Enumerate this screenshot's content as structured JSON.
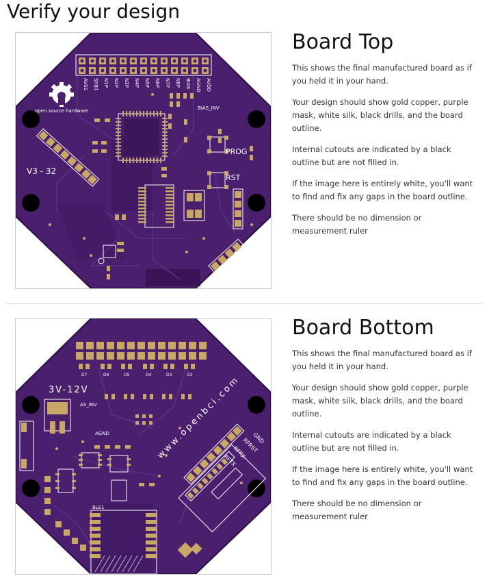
{
  "page": {
    "title": "Verify your design"
  },
  "sections": [
    {
      "heading": "Board Top",
      "paragraphs": [
        "This shows the final manufactured board as if you held it in your hand.",
        "Your design should show gold copper, purple mask, white silk, black drills, and the board outline.",
        "Internal cutouts are indicated by a black outline but are not filled in.",
        "If the image here is entirely white, you'll want to find and fix any gaps in the board outline.",
        "There should be no dimension or measurement ruler"
      ],
      "silk": {
        "version": "V3 - 32",
        "logo": "open source hardware",
        "prog": "PROG",
        "rst": "RST",
        "bias_inv": "BIAS_INV",
        "header_labels": [
          "AVSS",
          "SRB1",
          "N1P",
          "N2P",
          "N3P",
          "N4P",
          "N5P",
          "N6P",
          "N7P",
          "N8P",
          "BIAS",
          "AGND",
          "AVDD"
        ]
      }
    },
    {
      "heading": "Board Bottom",
      "paragraphs": [
        "This shows the final manufactured board as if you held it in your hand.",
        "Your design should show gold copper, purple mask, white silk, black drills, and the board outline.",
        "Internal cutouts are indicated by a black outline but are not filled in.",
        "If the image here is entirely white, you'll want to find and fix any gaps in the board outline.",
        "There should be no dimension or measurement ruler"
      ],
      "silk": {
        "voltage": "3V-12V",
        "url": "www.openbci.com",
        "ble": "BLE1",
        "header_labels": [
          "D7",
          "D6",
          "D5",
          "D4",
          "D3",
          "D2"
        ],
        "rf_labels": [
          "GND",
          "RFRST",
          "RFRX",
          "RFTX"
        ],
        "as_inv": "AS_INV",
        "agnd": "AGND"
      }
    }
  ],
  "colors": {
    "mask": "#4a1f6e",
    "mask_dark": "#3b1659",
    "copper": "#c9a866",
    "silk": "#ffffff",
    "drill": "#000000"
  }
}
